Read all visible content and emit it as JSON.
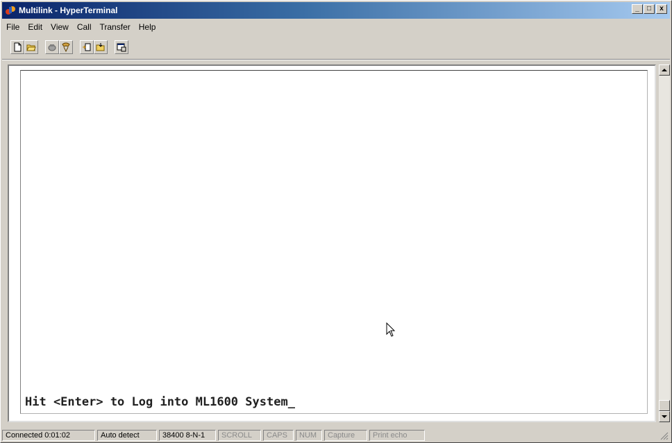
{
  "window": {
    "title": "Multilink - HyperTerminal",
    "min_label": "_",
    "max_label": "□",
    "close_label": "x"
  },
  "menu": [
    "File",
    "Edit",
    "View",
    "Call",
    "Transfer",
    "Help"
  ],
  "toolbar": {
    "buttons": [
      "new-icon",
      "open-icon",
      "disconnect-icon",
      "dial-icon",
      "send-icon",
      "receive-icon",
      "properties-icon"
    ]
  },
  "terminal": {
    "line": "Hit <Enter> to Log into ML1600 System_"
  },
  "status": {
    "connected": "Connected 0:01:02",
    "detect": "Auto detect",
    "baud": "38400 8-N-1",
    "scroll": "SCROLL",
    "caps": "CAPS",
    "num": "NUM",
    "capture": "Capture",
    "print_echo": "Print echo"
  },
  "colors": {
    "title_gradient_start": "#0a246a",
    "title_gradient_end": "#a6caf0",
    "chrome": "#d4d0c8"
  }
}
